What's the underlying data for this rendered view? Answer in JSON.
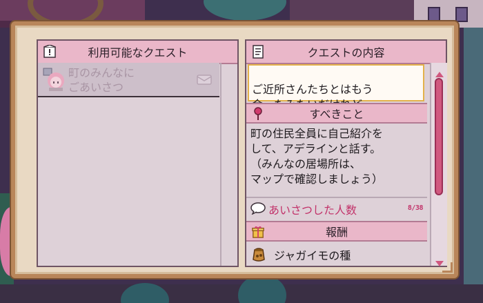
{
  "available_quests": {
    "header": "利用可能なクエスト",
    "header_icon": "quest-scroll-icon",
    "items": [
      {
        "title": "町のみんなに\nごあいさつ",
        "icon": "villager-avatar-icon",
        "status_icon": "mail-icon"
      }
    ]
  },
  "quest_details": {
    "header": "クエストの内容",
    "header_icon": "document-icon",
    "description": "ご近所さんたちとはもう\n会ったみたいだけれど...",
    "todo_header": "すべきこと",
    "todo_icon": "pin-icon",
    "todo_text": "町の住民全員に自己紹介を\nして、アデラインと話す。\n（みんなの居場所は、\nマップで確認しましょう）",
    "progress_label": "あいさつした人数",
    "progress_icon": "speech-bubble-icon",
    "progress_count": "8/38",
    "reward_header": "報酬",
    "reward_icon": "gift-icon",
    "rewards": [
      {
        "label": "ジャガイモの種",
        "icon": "seed-bag-icon"
      }
    ]
  },
  "colors": {
    "header_pink": "#eab7c9",
    "panel_bg": "#ded1d8",
    "accent": "#c2336a",
    "parchment": "#e9d9c3"
  }
}
